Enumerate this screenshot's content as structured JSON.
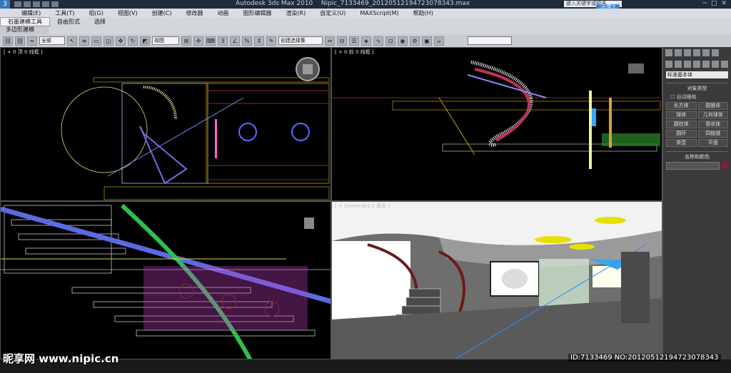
{
  "title_bar": {
    "app_title": "Autodesk 3ds Max 2010",
    "file_title": "Nipic_7133469_20120512194723078343.max",
    "search_placeholder": "键入关键字或短语",
    "xunlei_label": "迅雷7"
  },
  "menu": {
    "items": [
      "编辑(E)",
      "工具(T)",
      "组(G)",
      "视图(V)",
      "创建(C)",
      "修改器",
      "动画",
      "图形编辑器",
      "渲染(R)",
      "自定义(U)",
      "MAXScript(M)",
      "帮助(H)"
    ]
  },
  "ribbon": {
    "tabs": [
      "石墨建模工具",
      "自由形式",
      "选择"
    ],
    "subtab": "多边形建模"
  },
  "toolbar": {
    "filter_select": "全部",
    "reference_select": "视图",
    "named_selection": "创建选择集"
  },
  "viewports": {
    "top_left": "[ + 0 顶 0 线框 ]",
    "top_right": "[ + 0 前 0 线框 ]",
    "bottom_left": "",
    "bottom_right": "[ + Camera01 0 真实 ]"
  },
  "command_panel": {
    "category_select": "标准基本体",
    "object_type_title": "对象类型",
    "autogrid_label": "自动栅格",
    "buttons": [
      "长方体",
      "圆锥体",
      "球体",
      "几何球体",
      "圆柱体",
      "管状体",
      "圆环",
      "四棱锥",
      "茶壶",
      "平面"
    ],
    "name_color_title": "名称和颜色",
    "object_color": "#8b1a3c"
  },
  "watermark": {
    "logo": "昵享网 www.nipic.cn",
    "id_text": "ID:7133469 NO:20120512194723078343"
  }
}
